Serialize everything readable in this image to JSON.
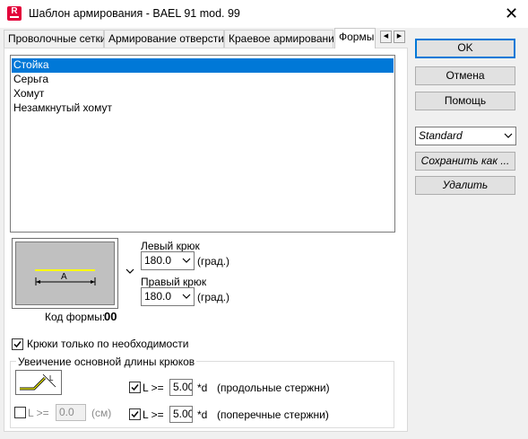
{
  "window": {
    "title": "Шаблон армирования - BAEL 91 mod. 99",
    "icon_letter": "R",
    "close_glyph": "✕"
  },
  "tabs": [
    {
      "label": "Проволочные сетки"
    },
    {
      "label": "Армирование отверстий"
    },
    {
      "label": "Краевое армирование"
    },
    {
      "label": "Формы",
      "active": true
    }
  ],
  "shapes": {
    "items": [
      "Стойка",
      "Серьга",
      "Хомут",
      "Незамкнутый хомут"
    ],
    "selected_index": 0
  },
  "shape_code": {
    "label": "Код формы:",
    "value": "00",
    "preview_letter": "A"
  },
  "hooks": {
    "left_label": "Левый крюк",
    "left_value": "180.0",
    "right_label": "Правый крюк",
    "right_value": "180.0",
    "unit": "(град.)"
  },
  "hooks_only_if_needed": {
    "label": "Крюки только по необходимости",
    "checked": true
  },
  "extension_group": {
    "title": "Увеичение основной длины крюков",
    "fixed": {
      "label": "L >=",
      "value": "0.0",
      "unit": "(см)",
      "checked": false
    },
    "longitudinal": {
      "label": "L >=",
      "value": "5.00",
      "suffix": "*d",
      "desc": "(продольные стержни)",
      "checked": true
    },
    "transverse": {
      "label": "L >=",
      "value": "5.00",
      "suffix": "*d",
      "desc": "(поперечные стержни)",
      "checked": true
    }
  },
  "buttons": {
    "ok": "OK",
    "cancel": "Отмена",
    "help": "Помощь",
    "save_as": "Сохранить как ...",
    "delete": "Удалить"
  },
  "template_select": {
    "value": "Standard"
  },
  "colors": {
    "selection": "#0078d7",
    "default_border": "#0078d7",
    "rebar": "#ffff00",
    "brand": "#e3003a"
  }
}
